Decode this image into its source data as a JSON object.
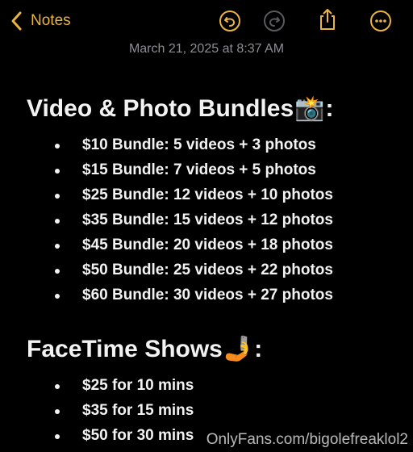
{
  "toolbar": {
    "back_label": "Notes",
    "accent_color": "#e9b440",
    "icons": [
      "chevron-left-icon",
      "undo-icon",
      "redo-icon",
      "share-icon",
      "more-icon"
    ]
  },
  "note": {
    "date": "March 21, 2025 at 8:37 AM",
    "sections": [
      {
        "heading": "Video & Photo Bundles",
        "heading_emoji": "📸",
        "heading_suffix": ":",
        "items": [
          "$10 Bundle: 5 videos + 3 photos",
          "$15 Bundle: 7 videos + 5 photos",
          "$25 Bundle: 12 videos + 10 photos",
          "$35 Bundle: 15 videos + 12 photos",
          "$45 Bundle: 20 videos + 18 photos",
          "$50 Bundle: 25 videos + 22 photos",
          "$60 Bundle: 30 videos + 27 photos"
        ]
      },
      {
        "heading": "FaceTime Shows",
        "heading_emoji": "🤳",
        "heading_suffix": ":",
        "items": [
          "$25 for 10 mins",
          "$35 for 15 mins",
          "$50 for 30 mins"
        ]
      }
    ]
  },
  "watermark": "OnlyFans.com/bigolefreaklol2"
}
